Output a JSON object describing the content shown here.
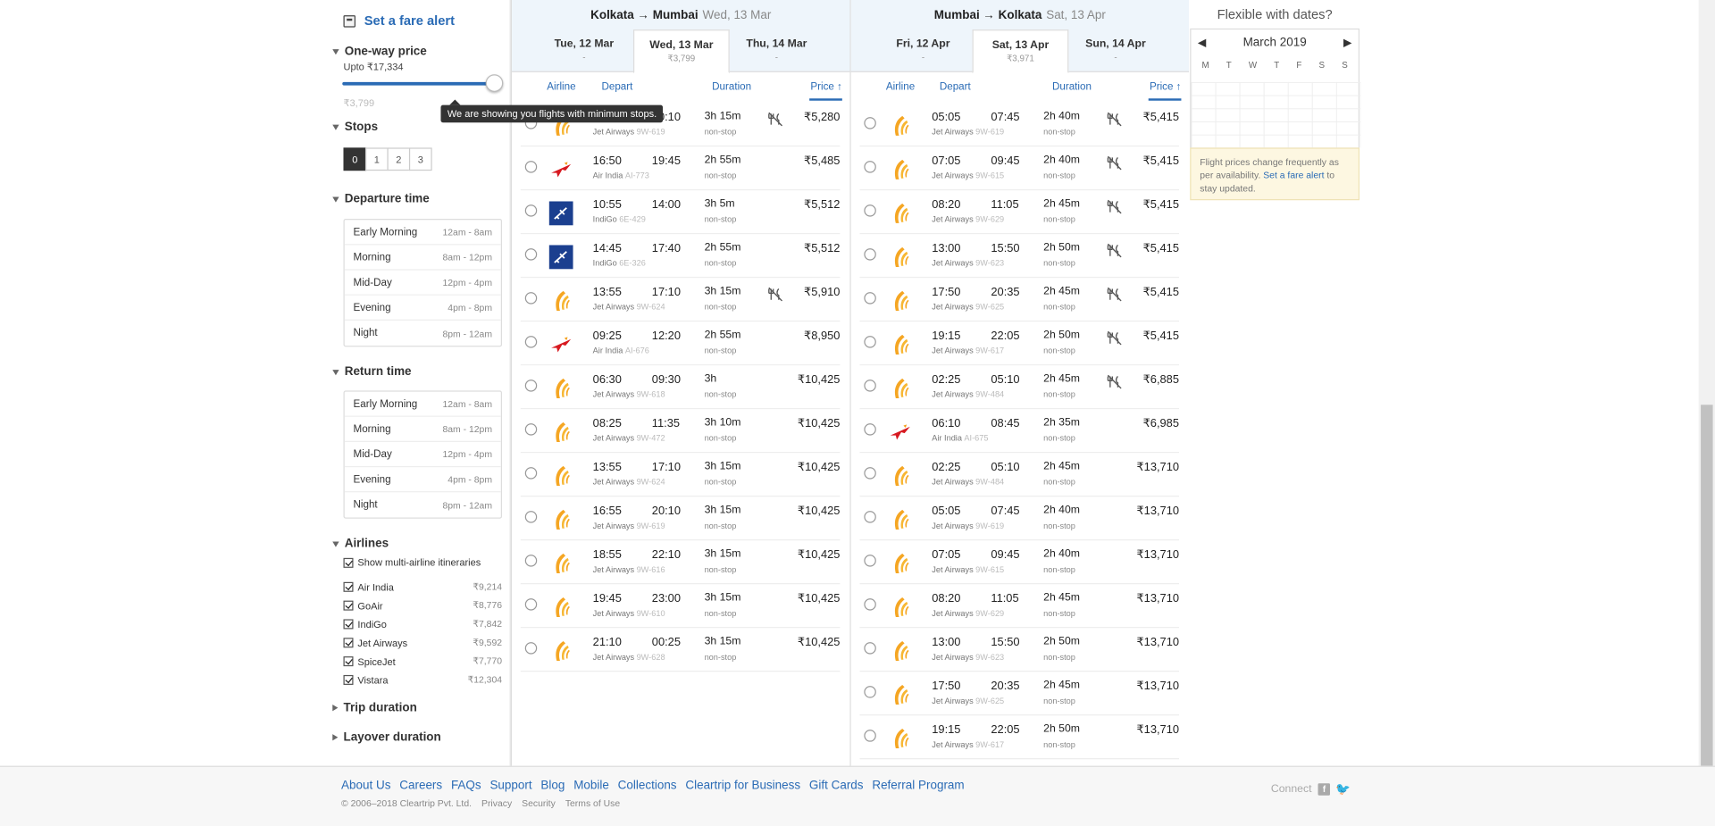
{
  "sidebar": {
    "fare_alert": "Set a fare alert",
    "oneway_title": "One-way price",
    "upto": "Upto ₹17,334",
    "min_price": "₹3,799",
    "max_price": "₹17,334",
    "tooltip": "We are showing you flights with minimum stops.",
    "stops_title": "Stops",
    "stops": [
      "0",
      "1",
      "2",
      "3"
    ],
    "departure_title": "Departure time",
    "return_title": "Return time",
    "times": [
      {
        "label": "Early Morning",
        "range": "12am - 8am"
      },
      {
        "label": "Morning",
        "range": "8am - 12pm"
      },
      {
        "label": "Mid-Day",
        "range": "12pm - 4pm"
      },
      {
        "label": "Evening",
        "range": "4pm - 8pm"
      },
      {
        "label": "Night",
        "range": "8pm - 12am"
      }
    ],
    "airlines_title": "Airlines",
    "multi": "Show multi-airline itineraries",
    "airlines": [
      {
        "name": "Air India",
        "price": "₹9,214"
      },
      {
        "name": "GoAir",
        "price": "₹8,776"
      },
      {
        "name": "IndiGo",
        "price": "₹7,842"
      },
      {
        "name": "Jet Airways",
        "price": "₹9,592"
      },
      {
        "name": "SpiceJet",
        "price": "₹7,770"
      },
      {
        "name": "Vistara",
        "price": "₹12,304"
      }
    ],
    "trip_duration": "Trip duration",
    "layover_duration": "Layover duration"
  },
  "outbound": {
    "route": "Kolkata → Mumbai",
    "date": "Wed, 13 Mar",
    "tabs": [
      {
        "label": "Tue, 12 Mar",
        "sub": "-"
      },
      {
        "label": "Wed, 13 Mar",
        "sub": "₹3,799"
      },
      {
        "label": "Thu, 14 Mar",
        "sub": "-"
      }
    ],
    "headers": {
      "airline": "Airline",
      "depart": "Depart",
      "duration": "Duration",
      "price": "Price ↑"
    },
    "flights": [
      {
        "logo": "jet",
        "dep": "",
        "arr": "20:10",
        "air": "Jet Airways",
        "fn": "9W-619",
        "dur": "3h 15m",
        "stop": "non-stop",
        "meal": true,
        "price": "₹5,280"
      },
      {
        "logo": "airindia",
        "dep": "16:50",
        "arr": "19:45",
        "air": "Air India",
        "fn": "AI-773",
        "dur": "2h 55m",
        "stop": "non-stop",
        "meal": false,
        "price": "₹5,485"
      },
      {
        "logo": "indigo",
        "dep": "10:55",
        "arr": "14:00",
        "air": "IndiGo",
        "fn": "6E-429",
        "dur": "3h 5m",
        "stop": "non-stop",
        "meal": false,
        "price": "₹5,512"
      },
      {
        "logo": "indigo",
        "dep": "14:45",
        "arr": "17:40",
        "air": "IndiGo",
        "fn": "6E-326",
        "dur": "2h 55m",
        "stop": "non-stop",
        "meal": false,
        "price": "₹5,512"
      },
      {
        "logo": "jet",
        "dep": "13:55",
        "arr": "17:10",
        "air": "Jet Airways",
        "fn": "9W-624",
        "dur": "3h 15m",
        "stop": "non-stop",
        "meal": true,
        "price": "₹5,910"
      },
      {
        "logo": "airindia",
        "dep": "09:25",
        "arr": "12:20",
        "air": "Air India",
        "fn": "AI-676",
        "dur": "2h 55m",
        "stop": "non-stop",
        "meal": false,
        "price": "₹8,950"
      },
      {
        "logo": "jet",
        "dep": "06:30",
        "arr": "09:30",
        "air": "Jet Airways",
        "fn": "9W-618",
        "dur": "3h",
        "stop": "non-stop",
        "meal": false,
        "price": "₹10,425"
      },
      {
        "logo": "jet",
        "dep": "08:25",
        "arr": "11:35",
        "air": "Jet Airways",
        "fn": "9W-472",
        "dur": "3h 10m",
        "stop": "non-stop",
        "meal": false,
        "price": "₹10,425"
      },
      {
        "logo": "jet",
        "dep": "13:55",
        "arr": "17:10",
        "air": "Jet Airways",
        "fn": "9W-624",
        "dur": "3h 15m",
        "stop": "non-stop",
        "meal": false,
        "price": "₹10,425"
      },
      {
        "logo": "jet",
        "dep": "16:55",
        "arr": "20:10",
        "air": "Jet Airways",
        "fn": "9W-619",
        "dur": "3h 15m",
        "stop": "non-stop",
        "meal": false,
        "price": "₹10,425"
      },
      {
        "logo": "jet",
        "dep": "18:55",
        "arr": "22:10",
        "air": "Jet Airways",
        "fn": "9W-616",
        "dur": "3h 15m",
        "stop": "non-stop",
        "meal": false,
        "price": "₹10,425"
      },
      {
        "logo": "jet",
        "dep": "19:45",
        "arr": "23:00",
        "air": "Jet Airways",
        "fn": "9W-610",
        "dur": "3h 15m",
        "stop": "non-stop",
        "meal": false,
        "price": "₹10,425"
      },
      {
        "logo": "jet",
        "dep": "21:10",
        "arr": "00:25",
        "air": "Jet Airways",
        "fn": "9W-628",
        "dur": "3h 15m",
        "stop": "non-stop",
        "meal": false,
        "price": "₹10,425"
      }
    ]
  },
  "inbound": {
    "route": "Mumbai → Kolkata",
    "date": "Sat, 13 Apr",
    "tabs": [
      {
        "label": "Fri, 12 Apr",
        "sub": "-"
      },
      {
        "label": "Sat, 13 Apr",
        "sub": "₹3,971"
      },
      {
        "label": "Sun, 14 Apr",
        "sub": "-"
      }
    ],
    "headers": {
      "airline": "Airline",
      "depart": "Depart",
      "duration": "Duration",
      "price": "Price ↑"
    },
    "flights": [
      {
        "logo": "jet",
        "dep": "05:05",
        "arr": "07:45",
        "air": "Jet Airways",
        "fn": "9W-619",
        "dur": "2h 40m",
        "stop": "non-stop",
        "meal": true,
        "price": "₹5,415"
      },
      {
        "logo": "jet",
        "dep": "07:05",
        "arr": "09:45",
        "air": "Jet Airways",
        "fn": "9W-615",
        "dur": "2h 40m",
        "stop": "non-stop",
        "meal": true,
        "price": "₹5,415"
      },
      {
        "logo": "jet",
        "dep": "08:20",
        "arr": "11:05",
        "air": "Jet Airways",
        "fn": "9W-629",
        "dur": "2h 45m",
        "stop": "non-stop",
        "meal": true,
        "price": "₹5,415"
      },
      {
        "logo": "jet",
        "dep": "13:00",
        "arr": "15:50",
        "air": "Jet Airways",
        "fn": "9W-623",
        "dur": "2h 50m",
        "stop": "non-stop",
        "meal": true,
        "price": "₹5,415"
      },
      {
        "logo": "jet",
        "dep": "17:50",
        "arr": "20:35",
        "air": "Jet Airways",
        "fn": "9W-625",
        "dur": "2h 45m",
        "stop": "non-stop",
        "meal": true,
        "price": "₹5,415"
      },
      {
        "logo": "jet",
        "dep": "19:15",
        "arr": "22:05",
        "air": "Jet Airways",
        "fn": "9W-617",
        "dur": "2h 50m",
        "stop": "non-stop",
        "meal": true,
        "price": "₹5,415"
      },
      {
        "logo": "jet",
        "dep": "02:25",
        "arr": "05:10",
        "air": "Jet Airways",
        "fn": "9W-484",
        "dur": "2h 45m",
        "stop": "non-stop",
        "meal": true,
        "price": "₹6,885"
      },
      {
        "logo": "airindia",
        "dep": "06:10",
        "arr": "08:45",
        "air": "Air India",
        "fn": "AI-675",
        "dur": "2h 35m",
        "stop": "non-stop",
        "meal": false,
        "price": "₹6,985"
      },
      {
        "logo": "jet",
        "dep": "02:25",
        "arr": "05:10",
        "air": "Jet Airways",
        "fn": "9W-484",
        "dur": "2h 45m",
        "stop": "non-stop",
        "meal": false,
        "price": "₹13,710"
      },
      {
        "logo": "jet",
        "dep": "05:05",
        "arr": "07:45",
        "air": "Jet Airways",
        "fn": "9W-619",
        "dur": "2h 40m",
        "stop": "non-stop",
        "meal": false,
        "price": "₹13,710"
      },
      {
        "logo": "jet",
        "dep": "07:05",
        "arr": "09:45",
        "air": "Jet Airways",
        "fn": "9W-615",
        "dur": "2h 40m",
        "stop": "non-stop",
        "meal": false,
        "price": "₹13,710"
      },
      {
        "logo": "jet",
        "dep": "08:20",
        "arr": "11:05",
        "air": "Jet Airways",
        "fn": "9W-629",
        "dur": "2h 45m",
        "stop": "non-stop",
        "meal": false,
        "price": "₹13,710"
      },
      {
        "logo": "jet",
        "dep": "13:00",
        "arr": "15:50",
        "air": "Jet Airways",
        "fn": "9W-623",
        "dur": "2h 50m",
        "stop": "non-stop",
        "meal": false,
        "price": "₹13,710"
      },
      {
        "logo": "jet",
        "dep": "17:50",
        "arr": "20:35",
        "air": "Jet Airways",
        "fn": "9W-625",
        "dur": "2h 45m",
        "stop": "non-stop",
        "meal": false,
        "price": "₹13,710"
      },
      {
        "logo": "jet",
        "dep": "19:15",
        "arr": "22:05",
        "air": "Jet Airways",
        "fn": "9W-617",
        "dur": "2h 50m",
        "stop": "non-stop",
        "meal": false,
        "price": "₹13,710"
      }
    ]
  },
  "flex": {
    "title": "Flexible with dates?",
    "month": "March 2019",
    "days": [
      "M",
      "T",
      "W",
      "T",
      "F",
      "S",
      "S"
    ],
    "note_pre": "Flight prices change frequently as per availability. ",
    "note_link": "Set a fare alert",
    "note_post": " to stay updated."
  },
  "footer": {
    "links": [
      "About Us",
      "Careers",
      "FAQs",
      "Support",
      "Blog",
      "Mobile",
      "Collections",
      "Cleartrip for Business",
      "Gift Cards",
      "Referral Program"
    ],
    "copy": [
      "© 2006–2018 Cleartrip Pvt. Ltd.",
      "Privacy",
      "Security",
      "Terms of Use"
    ],
    "connect": "Connect"
  }
}
